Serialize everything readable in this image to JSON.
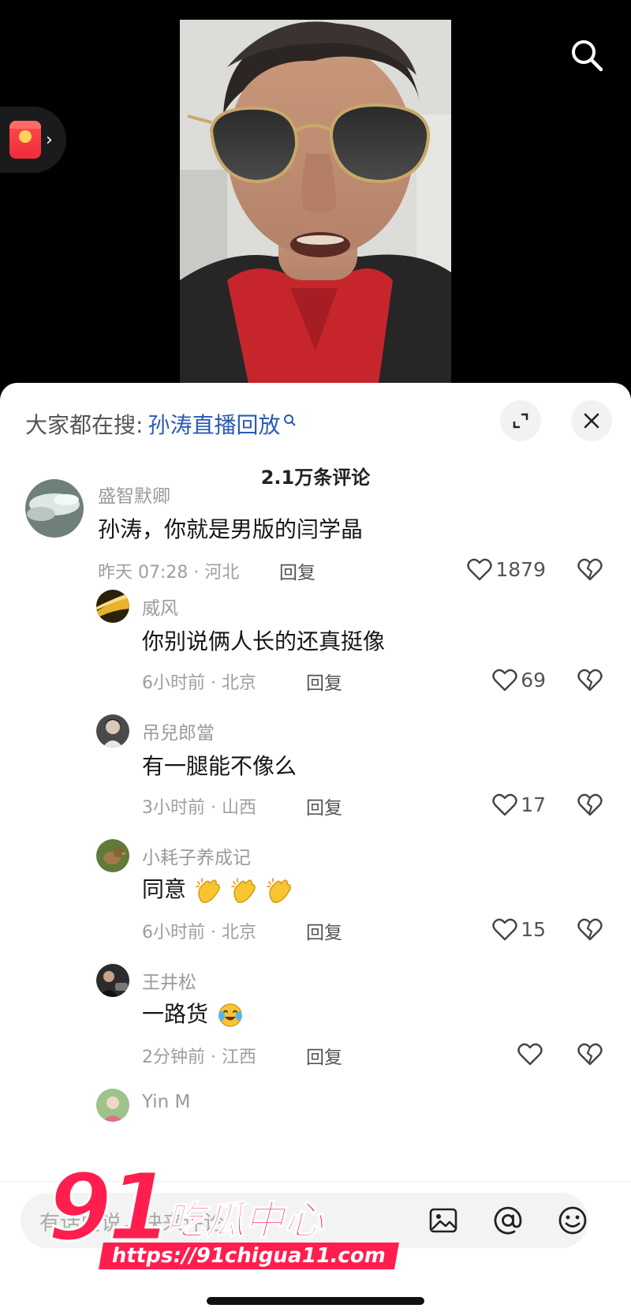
{
  "hot_search": {
    "label": "大家都在搜:",
    "term": "孙涛直播回放"
  },
  "comment_count": "2.1万条评论",
  "comments": [
    {
      "name": "盛智默卿",
      "text": "孙涛，你就是男版的闫学晶",
      "meta": "昨天 07:28 · 河北",
      "reply": "回复",
      "likes": "1879",
      "avatar_icon": "sky-avatar"
    },
    {
      "name": "威风",
      "text": "你别说俩人长的还真挺像",
      "meta": "6小时前 · 北京",
      "reply": "回复",
      "likes": "69",
      "avatar_icon": "gold-light-avatar"
    },
    {
      "name": "吊兒郎當",
      "text": "有一腿能不像么",
      "meta": "3小时前 · 山西",
      "reply": "回复",
      "likes": "17",
      "avatar_icon": "portrait-avatar"
    },
    {
      "name": "小耗子养成记",
      "text": "同意",
      "meta": "6小时前 · 北京",
      "reply": "回复",
      "likes": "15",
      "avatar_icon": "bird-avatar",
      "emojis": [
        "clap-emoji",
        "clap-emoji",
        "clap-emoji"
      ]
    },
    {
      "name": "王井松",
      "text": "一路货",
      "meta": "2分钟前 · 江西",
      "reply": "回复",
      "likes": "",
      "avatar_icon": "car-avatar",
      "emojis": [
        "crying-laugh-emoji"
      ]
    },
    {
      "name": "Yin M",
      "avatar_icon": "flower-avatar"
    }
  ],
  "input": {
    "placeholder": "有话要说，快来评论"
  },
  "icons": {
    "search": "search-icon",
    "redpacket": "red-packet-icon",
    "expand": "expand-icon",
    "close": "close-icon",
    "like": "heart-icon",
    "dislike": "broken-heart-icon",
    "image": "image-icon",
    "mention": "at-icon",
    "emoji": "smiley-icon"
  },
  "colors": {
    "accent_link": "#2a5ab7",
    "watermark": "#ff1e4e"
  },
  "watermark": {
    "number": "91",
    "name": "吃瓜中心",
    "url": "https://91chigua11.com"
  }
}
